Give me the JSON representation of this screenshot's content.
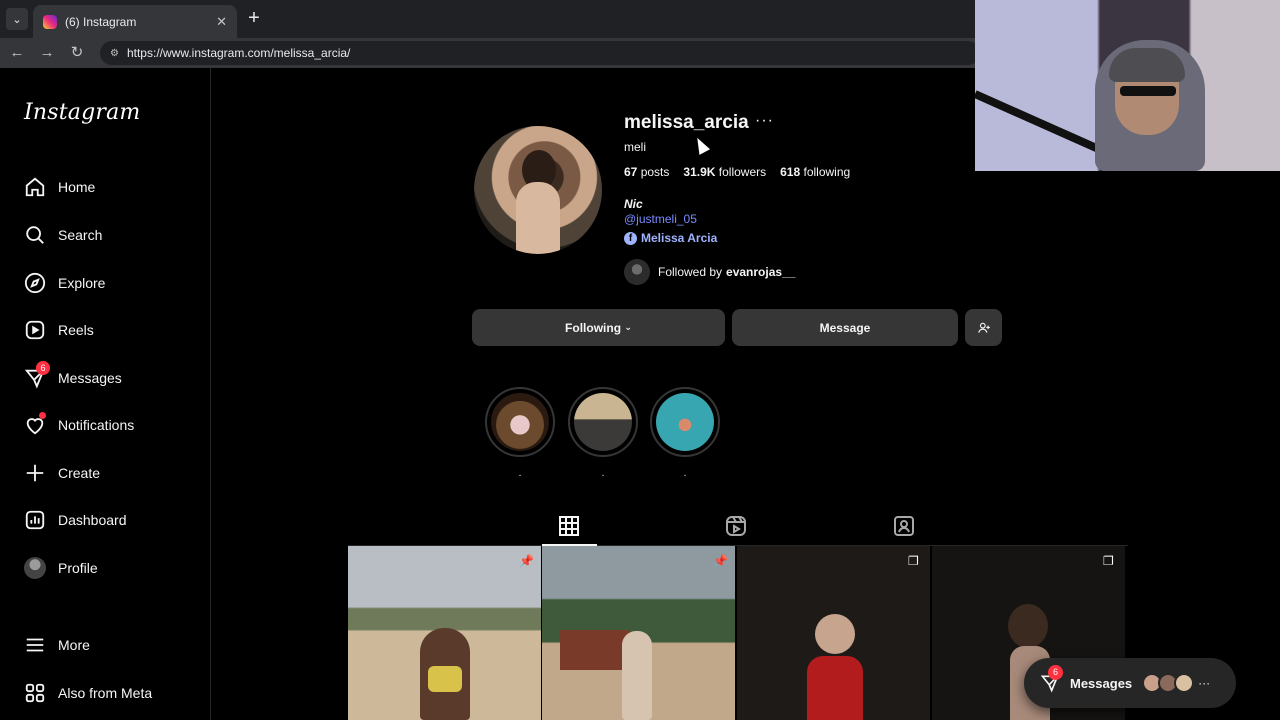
{
  "browser": {
    "tab_title": "(6) Instagram",
    "url": "https://www.instagram.com/melissa_arcia/"
  },
  "sidebar": {
    "logo": "Instagram",
    "items": [
      {
        "label": "Home",
        "icon": "home-icon"
      },
      {
        "label": "Search",
        "icon": "search-icon"
      },
      {
        "label": "Explore",
        "icon": "explore-icon"
      },
      {
        "label": "Reels",
        "icon": "reels-icon"
      },
      {
        "label": "Messages",
        "icon": "messages-icon",
        "badge": "6"
      },
      {
        "label": "Notifications",
        "icon": "heart-icon"
      },
      {
        "label": "Create",
        "icon": "plus-icon"
      },
      {
        "label": "Dashboard",
        "icon": "dashboard-icon"
      },
      {
        "label": "Profile",
        "icon": "avatar"
      }
    ],
    "bottom": [
      {
        "label": "More",
        "icon": "hamburger-icon"
      },
      {
        "label": "Also from Meta",
        "icon": "meta-icon"
      }
    ]
  },
  "profile": {
    "username": "melissa_arcia",
    "short_name": "meli",
    "posts_count": "67",
    "posts_label": "posts",
    "followers_count": "31.9K",
    "followers_label": "followers",
    "following_count": "618",
    "following_label": "following",
    "bio_name": "Nic",
    "bio_mention": "@justmeli_05",
    "bio_link": "Melissa Arcia",
    "followed_by_prefix": "Followed by",
    "followed_by_user": "evanrojas__"
  },
  "actions": {
    "following_label": "Following",
    "message_label": "Message"
  },
  "highlights": [
    {
      "label": "."
    },
    {
      "label": "."
    },
    {
      "label": "."
    }
  ],
  "messages_pill": {
    "label": "Messages",
    "badge": "6"
  },
  "colors": {
    "accent_link": "#7a8bff",
    "badge_red": "#ff3040",
    "button_bg": "#363636"
  }
}
